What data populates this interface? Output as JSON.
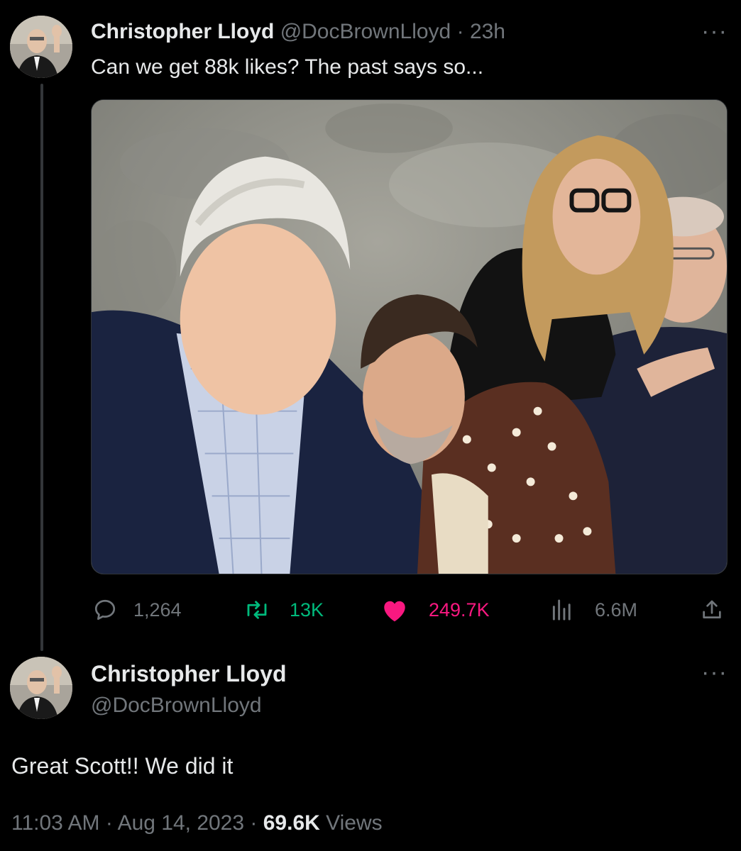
{
  "tweet": {
    "author_name": "Christopher Lloyd",
    "author_handle": "@DocBrownLloyd",
    "separator": "·",
    "time_ago": "23h",
    "text": "Can we get 88k likes? The past says so...",
    "more_label": "···",
    "stats": {
      "replies": "1,264",
      "retweets": "13K",
      "likes": "249.7K",
      "views": "6.6M"
    }
  },
  "reply": {
    "author_name": "Christopher Lloyd",
    "author_handle": "@DocBrownLloyd",
    "text": "Great Scott!! We did it",
    "more_label": "···",
    "time": "11:03 AM",
    "separator": "·",
    "date": "Aug 14, 2023",
    "views_count": "69.6K",
    "views_label": "Views"
  },
  "colors": {
    "background": "#000000",
    "text_primary": "#e7e9ea",
    "text_secondary": "#71767b",
    "retweet": "#00ba7c",
    "like": "#f91880"
  },
  "icons": [
    "reply-icon",
    "retweet-icon",
    "like-icon",
    "views-icon",
    "share-icon",
    "more-icon"
  ]
}
